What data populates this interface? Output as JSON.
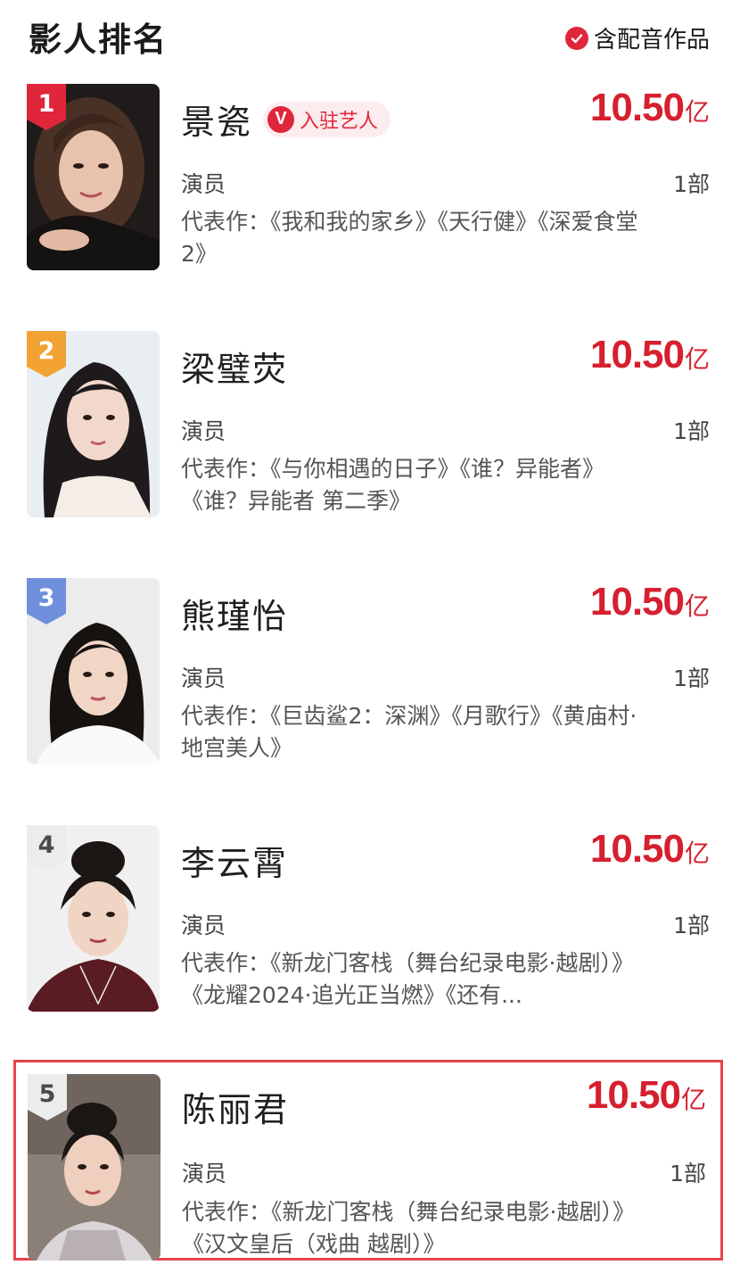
{
  "header": {
    "title": "影人排名",
    "filter_label": "含配音作品",
    "filter_checked": true,
    "accent_color": "#e0263a"
  },
  "ranking": [
    {
      "rank": "1",
      "badge_color": "#e0263a",
      "name": "景瓷",
      "tag": "入驻艺人",
      "tag_icon": "V",
      "boxoffice": "10.50",
      "unit": "亿",
      "role": "演员",
      "count": "1部",
      "works": "代表作：《我和我的家乡》《天行健》《深爱食堂2》"
    },
    {
      "rank": "2",
      "badge_color": "#f2a233",
      "name": "梁璧荧",
      "boxoffice": "10.50",
      "unit": "亿",
      "role": "演员",
      "count": "1部",
      "works": "代表作：《与你相遇的日子》《谁？异能者》《谁？异能者 第二季》"
    },
    {
      "rank": "3",
      "badge_color": "#6f8fdc",
      "name": "熊瑾怡",
      "boxoffice": "10.50",
      "unit": "亿",
      "role": "演员",
      "count": "1部",
      "works": "代表作：《巨齿鲨2：深渊》《月歌行》《黄庙村·地宫美人》"
    },
    {
      "rank": "4",
      "badge_color": "#ececec",
      "name": "李云霄",
      "boxoffice": "10.50",
      "unit": "亿",
      "role": "演员",
      "count": "1部",
      "works": "代表作：《新龙门客栈（舞台纪录电影·越剧）》《龙耀2024·追光正当燃》《还有..."
    },
    {
      "rank": "5",
      "badge_color": "#ececec",
      "name": "陈丽君",
      "boxoffice": "10.50",
      "unit": "亿",
      "role": "演员",
      "count": "1部",
      "works": "代表作：《新龙门客栈（舞台纪录电影·越剧）》《汉文皇后（戏曲 越剧）》",
      "highlighted": true
    }
  ]
}
